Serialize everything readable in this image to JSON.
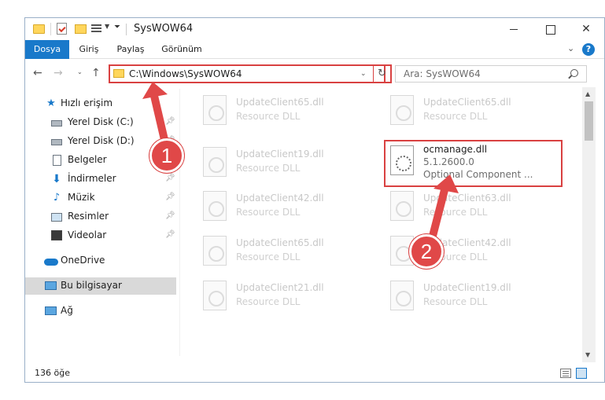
{
  "window": {
    "title": "SysWOW64"
  },
  "ribbon": {
    "tabs": [
      {
        "label": "Dosya",
        "active": true
      },
      {
        "label": "Giriş"
      },
      {
        "label": "Paylaş"
      },
      {
        "label": "Görünüm"
      }
    ],
    "help": "?"
  },
  "navigation": {
    "address": "C:\\Windows\\SysWOW64",
    "search_placeholder": "Ara: SysWOW64"
  },
  "sidebar": {
    "items": [
      {
        "label": "Hızlı erişim",
        "icon": "star-icon"
      },
      {
        "label": "Yerel Disk (C:)",
        "icon": "drive-icon",
        "pinned": true
      },
      {
        "label": "Yerel Disk (D:)",
        "icon": "drive-icon",
        "pinned": true
      },
      {
        "label": "Belgeler",
        "icon": "document-icon",
        "pinned": true
      },
      {
        "label": "İndirmeler",
        "icon": "download-icon",
        "pinned": true
      },
      {
        "label": "Müzik",
        "icon": "music-icon",
        "pinned": true
      },
      {
        "label": "Resimler",
        "icon": "pictures-icon",
        "pinned": true
      },
      {
        "label": "Videolar",
        "icon": "videos-icon",
        "pinned": true
      },
      {
        "label": "OneDrive",
        "icon": "onedrive-icon"
      },
      {
        "label": "Bu bilgisayar",
        "icon": "computer-icon",
        "selected": true
      },
      {
        "label": "Ağ",
        "icon": "network-icon"
      }
    ]
  },
  "files": {
    "left": [
      {
        "name": "UpdateClient65.dll",
        "type": "Resource DLL"
      },
      {
        "name": "UpdateClient19.dll",
        "type": "Resource DLL"
      },
      {
        "name": "UpdateClient42.dll",
        "type": "Resource DLL"
      },
      {
        "name": "UpdateClient65.dll",
        "type": "Resource DLL"
      },
      {
        "name": "UpdateClient21.dll",
        "type": "Resource DLL"
      }
    ],
    "right": [
      {
        "name": "UpdateClient65.dll",
        "type": "Resource DLL"
      },
      {
        "name": "ocmanage.dll",
        "version": "5.1.2600.0",
        "type": "Optional Component ...",
        "active": true
      },
      {
        "name": "UpdateClient63.dll",
        "type": "Resource DLL"
      },
      {
        "name": "UpdateClient42.dll",
        "type": "Resource DLL"
      },
      {
        "name": "UpdateClient19.dll",
        "type": "Resource DLL"
      }
    ]
  },
  "status": {
    "item_count": "136 öğe"
  },
  "annotations": {
    "badge1": "1",
    "badge2": "2",
    "color": "#d94141"
  }
}
